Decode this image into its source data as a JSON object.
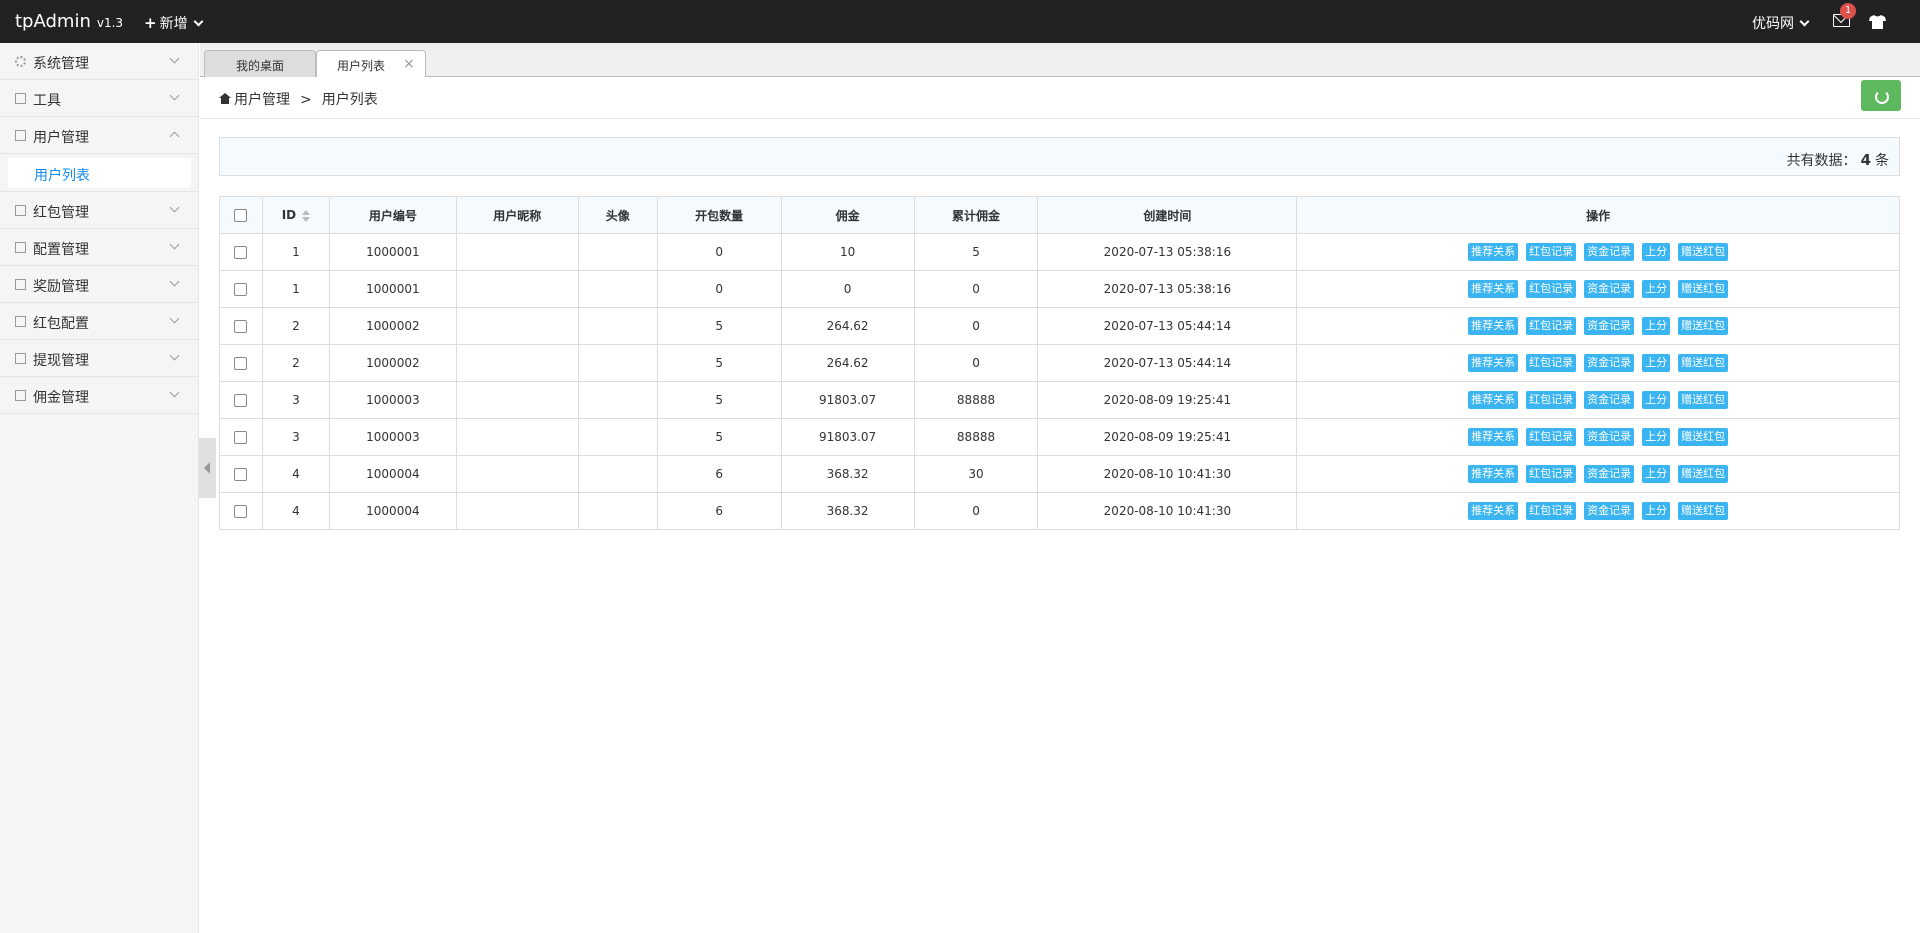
{
  "app": {
    "name": "tpAdmin",
    "version": "v1.3"
  },
  "topbar": {
    "new_label": "新增",
    "site_label": "优码网",
    "notify_count": "1"
  },
  "sidebar": {
    "items": [
      {
        "label": "系统管理",
        "expanded": false
      },
      {
        "label": "工具",
        "expanded": false
      },
      {
        "label": "用户管理",
        "expanded": true
      },
      {
        "label": "红包管理",
        "expanded": false
      },
      {
        "label": "配置管理",
        "expanded": false
      },
      {
        "label": "奖励管理",
        "expanded": false
      },
      {
        "label": "红包配置",
        "expanded": false
      },
      {
        "label": "提现管理",
        "expanded": false
      },
      {
        "label": "佣金管理",
        "expanded": false
      }
    ],
    "active_sub": "用户列表"
  },
  "tabs": [
    {
      "label": "我的桌面"
    },
    {
      "label": "用户列表",
      "close": "×"
    }
  ],
  "breadcrumb": {
    "parent": "用户管理",
    "sep": ">",
    "current": "用户列表"
  },
  "summary": {
    "prefix": "共有数据：",
    "count": "4",
    "suffix": "条"
  },
  "table": {
    "headers": [
      "ID",
      "用户编号",
      "用户昵称",
      "头像",
      "开包数量",
      "佣金",
      "累计佣金",
      "创建时间",
      "操作"
    ],
    "actions": [
      "推荐关系",
      "红包记录",
      "资金记录",
      "上分",
      "赠送红包"
    ],
    "rows": [
      {
        "id": "1",
        "no": "1000001",
        "nick": "",
        "avatar": "",
        "opens": "0",
        "commission": "10",
        "total": "5",
        "created": "2020-07-13 05:38:16"
      },
      {
        "id": "1",
        "no": "1000001",
        "nick": "",
        "avatar": "",
        "opens": "0",
        "commission": "0",
        "total": "0",
        "created": "2020-07-13 05:38:16"
      },
      {
        "id": "2",
        "no": "1000002",
        "nick": "",
        "avatar": "",
        "opens": "5",
        "commission": "264.62",
        "total": "0",
        "created": "2020-07-13 05:44:14"
      },
      {
        "id": "2",
        "no": "1000002",
        "nick": "",
        "avatar": "",
        "opens": "5",
        "commission": "264.62",
        "total": "0",
        "created": "2020-07-13 05:44:14"
      },
      {
        "id": "3",
        "no": "1000003",
        "nick": "",
        "avatar": "",
        "opens": "5",
        "commission": "91803.07",
        "total": "88888",
        "created": "2020-08-09 19:25:41"
      },
      {
        "id": "3",
        "no": "1000003",
        "nick": "",
        "avatar": "",
        "opens": "5",
        "commission": "91803.07",
        "total": "88888",
        "created": "2020-08-09 19:25:41"
      },
      {
        "id": "4",
        "no": "1000004",
        "nick": "",
        "avatar": "",
        "opens": "6",
        "commission": "368.32",
        "total": "30",
        "created": "2020-08-10 10:41:30"
      },
      {
        "id": "4",
        "no": "1000004",
        "nick": "",
        "avatar": "",
        "opens": "6",
        "commission": "368.32",
        "total": "0",
        "created": "2020-08-10 10:41:30"
      }
    ]
  },
  "colors": {
    "topbar": "#222222",
    "accent": "#148cf1",
    "action_button": "#3bb4f2",
    "refresh_button": "#5eb95e",
    "badge": "#dd514c"
  }
}
